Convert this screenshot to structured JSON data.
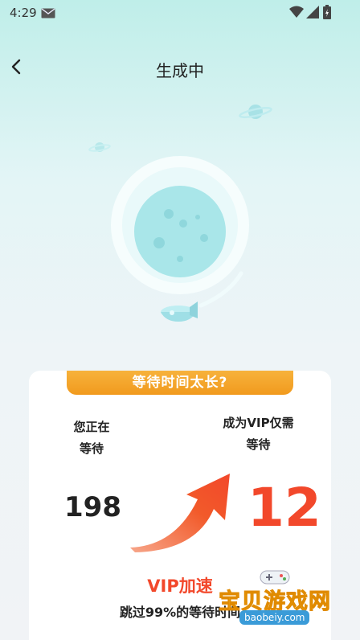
{
  "status_bar": {
    "time": "4:29"
  },
  "header": {
    "title": "生成中"
  },
  "card": {
    "banner": "等待时间太长?",
    "left_label_line1": "您正在",
    "left_label_line2": "等待",
    "right_label_line1": "成为VIP仅需",
    "right_label_line2": "等待",
    "wait_value": "198",
    "vip_value": "12",
    "vip_speed": "VIP加速",
    "skip_text": "跳过99%的等待时间"
  },
  "watermark": {
    "text": "宝贝游戏网",
    "url": "baobeiy.com"
  },
  "colors": {
    "accent": "#f2482b",
    "banner": "#f19a1d",
    "moon": "#a9e6e9"
  }
}
